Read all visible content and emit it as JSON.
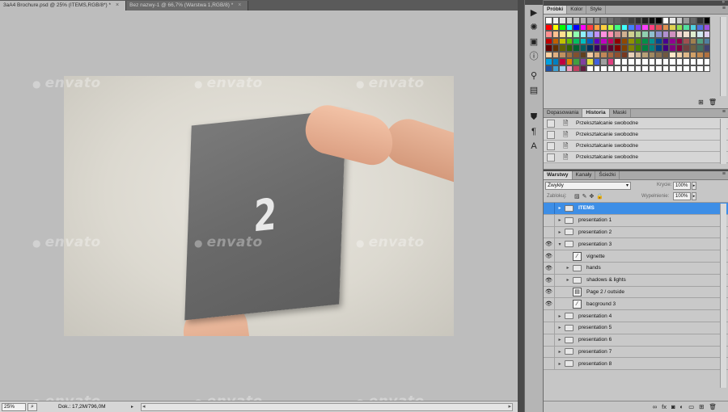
{
  "document_tabs": [
    {
      "label": "3aA4 Brochure.psd @ 25% (ITEMS,RGB/8*) *",
      "active": true
    },
    {
      "label": "Bez nazwy-1 @ 66,7% (Warstwa 1,RGB/8) *",
      "active": false
    }
  ],
  "canvas": {
    "page_number": "2",
    "watermark": "envato"
  },
  "status_bar": {
    "zoom": "25%",
    "doc_info": "Dok.: 17,2M/796,0M"
  },
  "swatches_panel": {
    "tabs": [
      "Próbki",
      "Kolor",
      "Style"
    ],
    "active_tab": 0,
    "colors": [
      "#ffffff",
      "#f0f0f0",
      "#e0e0e0",
      "#d0d0d0",
      "#c0c0c0",
      "#b0b0b0",
      "#a0a0a0",
      "#909090",
      "#808080",
      "#707070",
      "#606060",
      "#505050",
      "#404040",
      "#303030",
      "#202020",
      "#101010",
      "#000000",
      "#ffffff",
      "#e8e8e8",
      "#cccccc",
      "#999999",
      "#666666",
      "#333333",
      "#000000",
      "#ff0000",
      "#ffff00",
      "#00ff00",
      "#00ffff",
      "#0000ff",
      "#ff00ff",
      "#ff4040",
      "#ffa040",
      "#ffd040",
      "#c0ff40",
      "#40ff80",
      "#40ffff",
      "#4080ff",
      "#8040ff",
      "#ff40ff",
      "#ff4080",
      "#e05050",
      "#e09050",
      "#e0d050",
      "#90e050",
      "#50e0a0",
      "#50d0e0",
      "#5070e0",
      "#a050e0",
      "#ff9090",
      "#ffc090",
      "#ffe090",
      "#e0ff90",
      "#90ffb0",
      "#90f0ff",
      "#90b0ff",
      "#c090ff",
      "#ff90e0",
      "#ff90b0",
      "#d09090",
      "#d0b090",
      "#d0d090",
      "#b0d090",
      "#90d0b0",
      "#90c0d0",
      "#9090d0",
      "#b090d0",
      "#d090c0",
      "#f0d0d0",
      "#f0e0d0",
      "#e0f0d0",
      "#d0e8f0",
      "#e0d0f0",
      "#c00000",
      "#c06000",
      "#c0c000",
      "#60c000",
      "#00c060",
      "#00c0c0",
      "#0060c0",
      "#6000c0",
      "#c000c0",
      "#c00060",
      "#900000",
      "#904800",
      "#909000",
      "#489000",
      "#009048",
      "#009090",
      "#004890",
      "#480090",
      "#900090",
      "#900048",
      "#a05050",
      "#a08050",
      "#50a080",
      "#5080a0",
      "#600000",
      "#603000",
      "#606000",
      "#306000",
      "#006030",
      "#006060",
      "#003060",
      "#300060",
      "#600060",
      "#600030",
      "#800000",
      "#804000",
      "#808000",
      "#408000",
      "#008040",
      "#008080",
      "#004080",
      "#400080",
      "#800080",
      "#800040",
      "#704040",
      "#706040",
      "#407060",
      "#404070",
      "#ffd0a0",
      "#e0b080",
      "#c09060",
      "#a07040",
      "#805030",
      "#604020",
      "#f0c8a0",
      "#d8a878",
      "#c08858",
      "#a86840",
      "#905030",
      "#783820",
      "#e8d0b8",
      "#d0b898",
      "#b8a078",
      "#a08860",
      "#887050",
      "#705840",
      "#ffe8c8",
      "#f0d0a8",
      "#e0b888",
      "#d0a068",
      "#c08850",
      "#b07040",
      "#00a0e0",
      "#0080c0",
      "#c00040",
      "#e08000",
      "#40a040",
      "#8040a0",
      "#e0e040",
      "#4060e0",
      "#a0a0a0",
      "#e04080",
      "#ffffff",
      "#ffffff",
      "#ffffff",
      "#ffffff",
      "#ffffff",
      "#ffffff",
      "#ffffff",
      "#ffffff",
      "#ffffff",
      "#ffffff",
      "#ffffff",
      "#ffffff",
      "#ffffff",
      "#ffffff",
      "#2050a0",
      "#40a0d0",
      "#a0d0f0",
      "#f0a0c0",
      "#c04060",
      "#602040",
      "#ffffff",
      "#ffffff",
      "#ffffff",
      "#ffffff",
      "#ffffff",
      "#ffffff",
      "#ffffff",
      "#ffffff",
      "#ffffff",
      "#ffffff",
      "#ffffff",
      "#ffffff",
      "#ffffff",
      "#ffffff",
      "#ffffff",
      "#ffffff",
      "#ffffff",
      "#ffffff"
    ]
  },
  "history_panel": {
    "tabs": [
      "Dopasowania",
      "Historia",
      "Maski"
    ],
    "active_tab": 1,
    "items": [
      "Przekształcanie swobodne",
      "Przekształcanie swobodne",
      "Przekształcanie swobodne",
      "Przekształcanie swobodne"
    ]
  },
  "layers_panel": {
    "tabs": [
      "Warstwy",
      "Kanały",
      "Ścieżki"
    ],
    "active_tab": 0,
    "blend_mode": "Zwykły",
    "opacity_label": "Krycie:",
    "opacity_value": "100%",
    "lock_label": "Zablokuj:",
    "fill_label": "Wypełnienie:",
    "fill_value": "100%",
    "layers": [
      {
        "name": "ITEMS",
        "type": "folder",
        "indent": 0,
        "visible": false,
        "expanded": false,
        "selected": true
      },
      {
        "name": "presentation 1",
        "type": "folder",
        "indent": 0,
        "visible": false,
        "expanded": false,
        "selected": false
      },
      {
        "name": "presentation 2",
        "type": "folder",
        "indent": 0,
        "visible": false,
        "expanded": false,
        "selected": false
      },
      {
        "name": "presentation 3",
        "type": "folder",
        "indent": 0,
        "visible": true,
        "expanded": true,
        "selected": false
      },
      {
        "name": "vignette",
        "type": "layer",
        "indent": 1,
        "visible": true,
        "expanded": false,
        "selected": false
      },
      {
        "name": "hands",
        "type": "folder",
        "indent": 1,
        "visible": true,
        "expanded": false,
        "selected": false
      },
      {
        "name": "shadows & lights",
        "type": "folder",
        "indent": 1,
        "visible": true,
        "expanded": false,
        "selected": false
      },
      {
        "name": "Page 2 / outside",
        "type": "smart",
        "indent": 1,
        "visible": true,
        "expanded": false,
        "selected": false
      },
      {
        "name": "bacground 3",
        "type": "layer",
        "indent": 1,
        "visible": true,
        "expanded": false,
        "selected": false
      },
      {
        "name": "presentation 4",
        "type": "folder",
        "indent": 0,
        "visible": false,
        "expanded": false,
        "selected": false
      },
      {
        "name": "presentation 5",
        "type": "folder",
        "indent": 0,
        "visible": false,
        "expanded": false,
        "selected": false
      },
      {
        "name": "presentation 6",
        "type": "folder",
        "indent": 0,
        "visible": false,
        "expanded": false,
        "selected": false
      },
      {
        "name": "presentation 7",
        "type": "folder",
        "indent": 0,
        "visible": false,
        "expanded": false,
        "selected": false
      },
      {
        "name": "presentation 8",
        "type": "folder",
        "indent": 0,
        "visible": false,
        "expanded": false,
        "selected": false
      }
    ],
    "footer_icons": [
      "link-icon",
      "fx-icon",
      "mask-icon",
      "adjustment-icon",
      "group-icon",
      "new-layer-icon",
      "trash-icon"
    ]
  },
  "dock_icons": [
    "play-icon",
    "gear-icon",
    "image-icon",
    "info-icon",
    "brush-icon",
    "clone-icon",
    "stamp-icon",
    "paragraph-icon",
    "character-icon"
  ]
}
